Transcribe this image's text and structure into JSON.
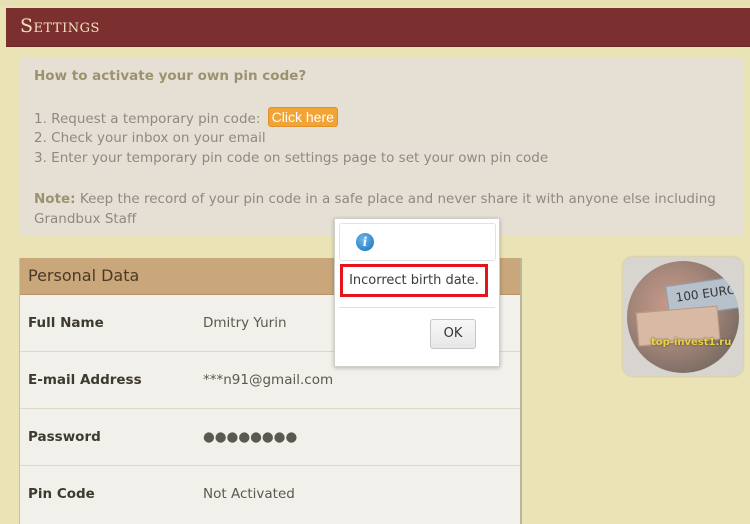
{
  "header": {
    "title": "Settings"
  },
  "pin_info": {
    "heading": "How to activate your own pin code?",
    "step1_text": "1. Request a temporary pin code:",
    "step1_button": "Click here",
    "step2": "2. Check your inbox on your email",
    "step3": "3. Enter your temporary pin code on settings page to set your own pin code",
    "note_label": "Note:",
    "note_text": "Keep the record of your pin code in a safe place and never share it with anyone else including Grandbux Staff"
  },
  "personal_data": {
    "title": "Personal Data",
    "rows": [
      {
        "label": "Full Name",
        "value": "Dmitry Yurin"
      },
      {
        "label": "E-mail Address",
        "value": "***n91@gmail.com"
      },
      {
        "label": "Password",
        "value": "●●●●●●●●"
      },
      {
        "label": "Pin Code",
        "value": "Not Activated"
      }
    ]
  },
  "promo": {
    "text": "top-invest1.ru",
    "bill_label": "100 EURO"
  },
  "dialog": {
    "icon": "info-icon",
    "message": "Incorrect birth date.",
    "ok_label": "OK"
  },
  "colors": {
    "header_bg": "#7c2f2f",
    "page_bg": "#eae3b5",
    "button_orange": "#f2a336",
    "error_outline": "#e3141d"
  }
}
